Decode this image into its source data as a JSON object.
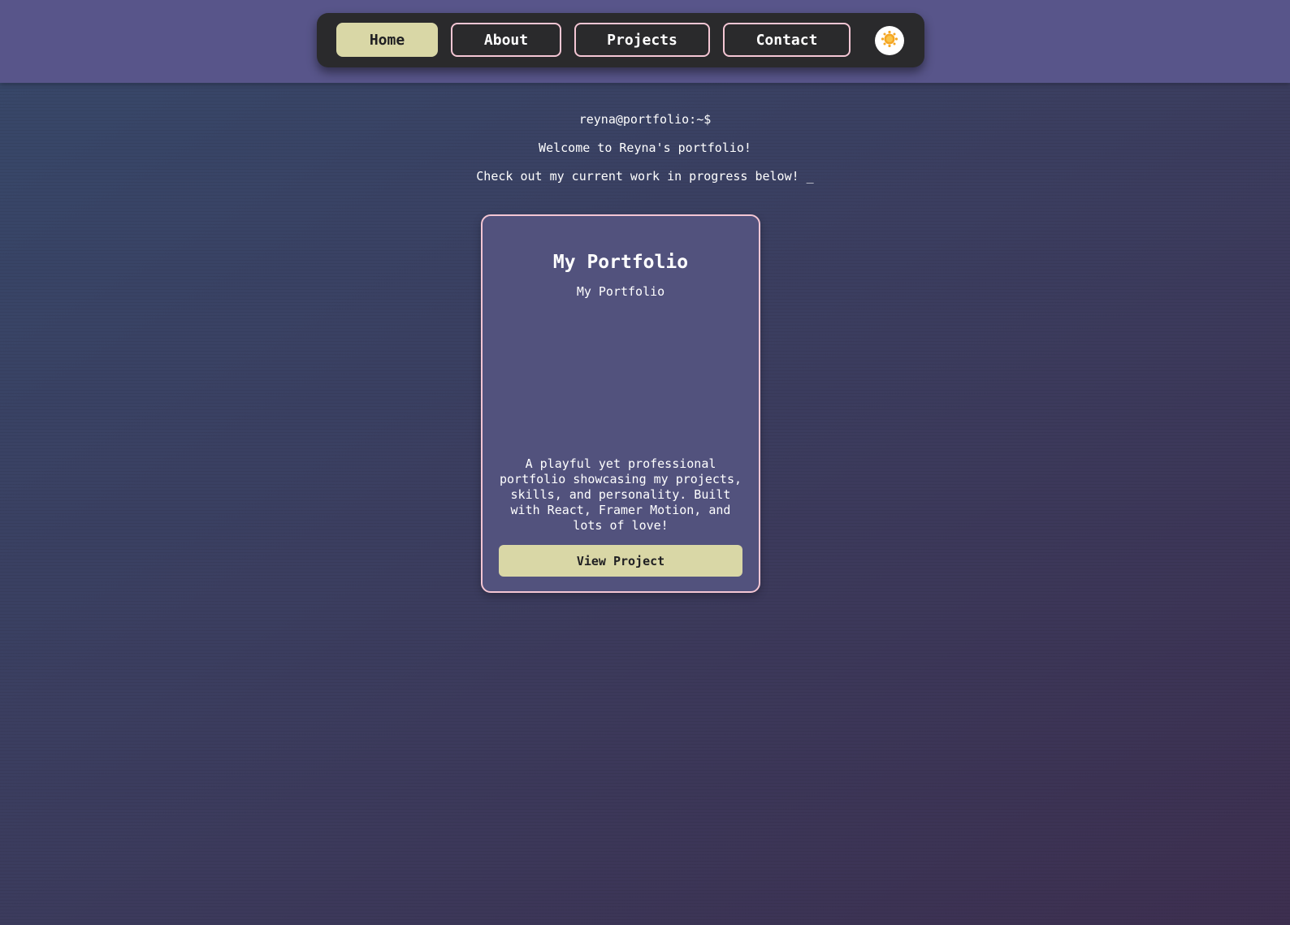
{
  "nav": {
    "items": [
      {
        "label": "Home",
        "active": true
      },
      {
        "label": "About",
        "active": false
      },
      {
        "label": "Projects",
        "active": false
      },
      {
        "label": "Contact",
        "active": false
      }
    ],
    "theme_toggle_icon": "sun-icon"
  },
  "terminal": {
    "prompt": "reyna@portfolio:~$",
    "welcome": "Welcome to Reyna's portfolio!",
    "message": "Check out my current work in progress below! _"
  },
  "project": {
    "title": "My Portfolio",
    "subtitle": "My Portfolio",
    "description": "A playful yet professional portfolio showcasing my projects, skills, and personality. Built with React, Framer Motion, and lots of love!",
    "button_label": "View Project"
  },
  "colors": {
    "header_band": "#58558a",
    "nav_bg": "#2a2a2c",
    "accent": "#d9d7a6",
    "border_pink": "#f4c6d4",
    "card_bg": "#52527d",
    "sun": "#f5a623"
  }
}
